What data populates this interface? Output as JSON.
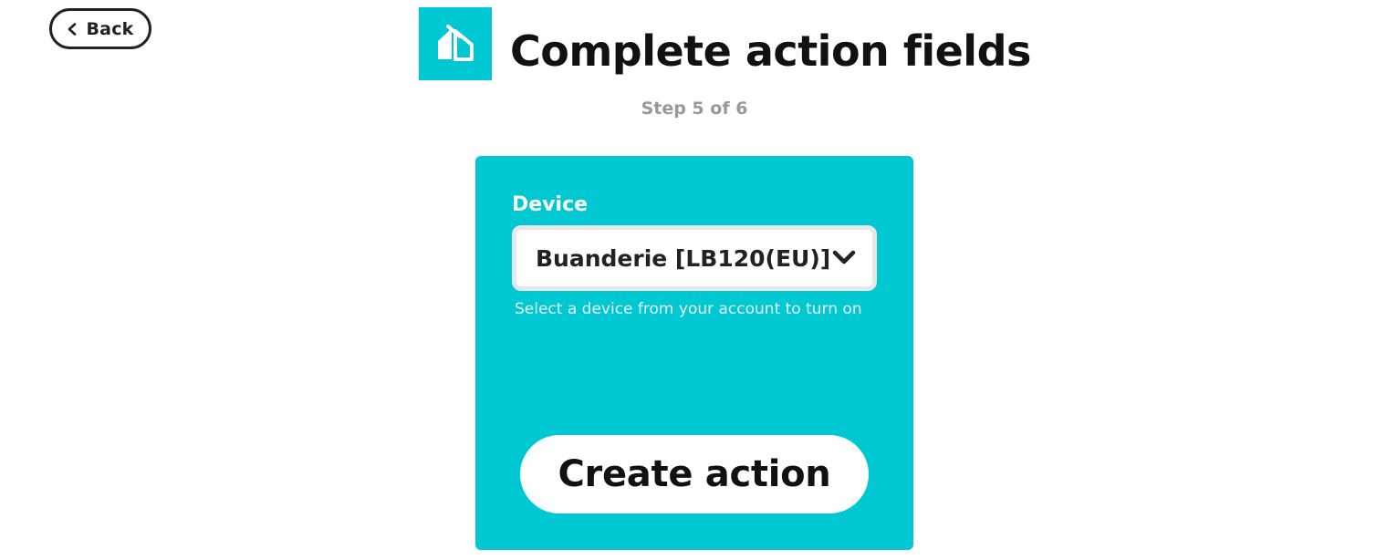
{
  "header": {
    "back_label": "Back",
    "title": "Complete action fields",
    "step": "Step 5 of 6",
    "service_logo_icon": "kasa-house-icon"
  },
  "form": {
    "field_label": "Device",
    "selected_device": "Buanderie [LB120(EU)]",
    "helper_text": "Select a device from your account to turn on",
    "submit_label": "Create action"
  },
  "colors": {
    "accent": "#00c8d2",
    "text": "#222222",
    "muted": "#999999",
    "background": "#ffffff"
  }
}
